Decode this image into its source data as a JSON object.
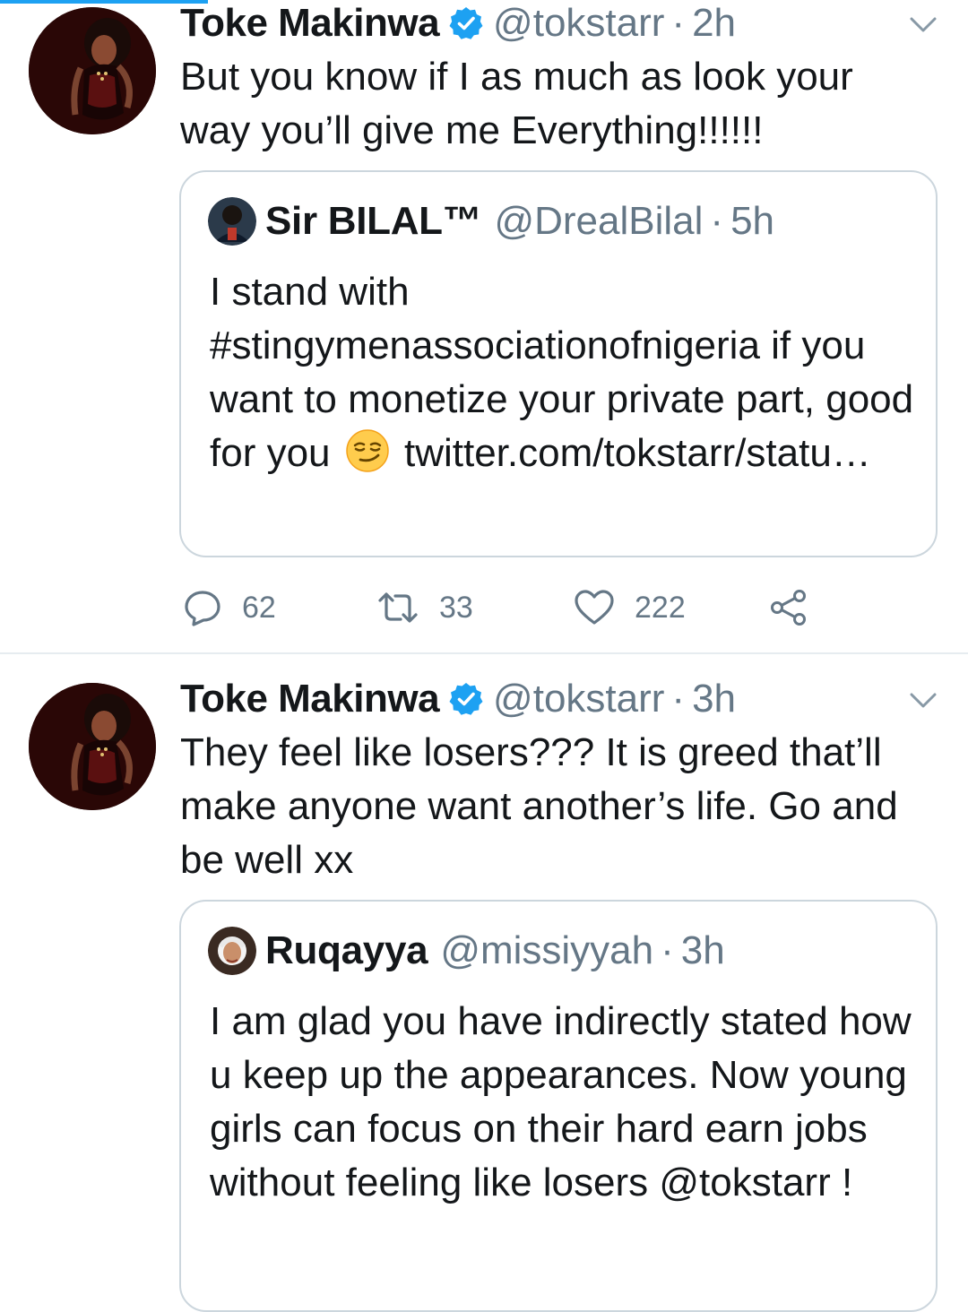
{
  "tweets": [
    {
      "author_name": "Toke Makinwa",
      "author_handle": "@tokstarr",
      "separator": "·",
      "time": "2h",
      "text": "But you know if I as much as look your way you’ll give me Everything!!!!!!",
      "quote": {
        "author_name": "Sir BILAL™",
        "author_handle": "@DrealBilal",
        "separator": "·",
        "time": "5h",
        "text_before_emoji": "I stand with #stingymenassociationofnigeria if you want to monetize your private part, good for you",
        "emoji": "smirking-face",
        "text_after_emoji": "twitter.com/tokstarr/statu…"
      },
      "actions": {
        "replies": "62",
        "retweets": "33",
        "likes": "222"
      }
    },
    {
      "author_name": "Toke Makinwa",
      "author_handle": "@tokstarr",
      "separator": "·",
      "time": "3h",
      "text": "They feel like losers??? It is greed that’ll make anyone want another’s life. Go and be well xx",
      "quote": {
        "author_name": "Ruqayya",
        "author_handle": "@missiyyah",
        "separator": "·",
        "time": "3h",
        "text": "I am glad you have indirectly stated how u keep up the appearances. Now young girls can focus on their hard earn jobs without feeling like losers @tokstarr !"
      }
    }
  ],
  "colors": {
    "accent": "#1da1f2",
    "text": "#14171a",
    "secondary_text": "#657786",
    "border": "#ccd6dd"
  },
  "icons": {
    "verified": "verified-badge-icon",
    "menu": "chevron-down-icon",
    "reply": "reply-icon",
    "retweet": "retweet-icon",
    "like": "heart-icon",
    "share": "share-icon"
  }
}
